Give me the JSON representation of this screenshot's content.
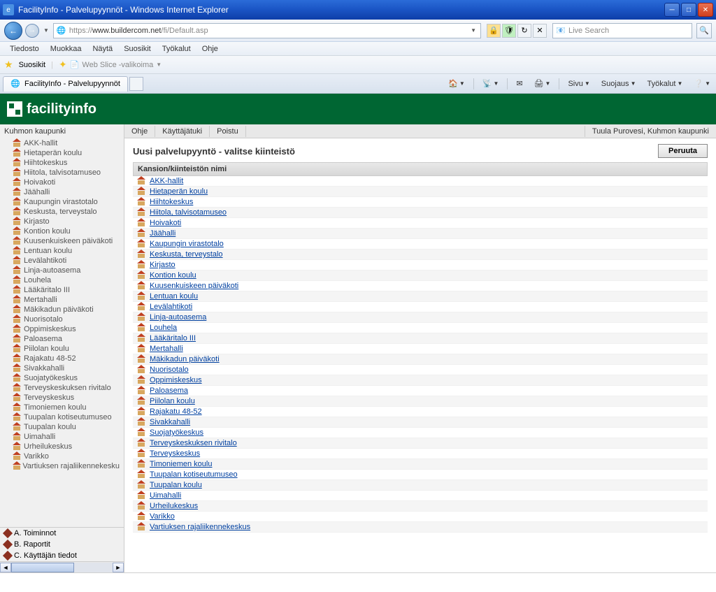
{
  "window": {
    "title": "FacilityInfo - Palvelupyynnöt - Windows Internet Explorer"
  },
  "address": {
    "protocol": "https://",
    "domain": "www.buildercom.net",
    "path": "/fi/Default.asp"
  },
  "search": {
    "placeholder": "Live Search"
  },
  "menus": {
    "tiedosto": "Tiedosto",
    "muokkaa": "Muokkaa",
    "nayta": "Näytä",
    "suosikit": "Suosikit",
    "tyokalut": "Työkalut",
    "ohje": "Ohje"
  },
  "favorites": {
    "label": "Suosikit",
    "webslice": "Web Slice -valikoima"
  },
  "tab": {
    "title": "FacilityInfo - Palvelupyynnöt"
  },
  "ie_toolbar": {
    "sivu": "Sivu",
    "suojaus": "Suojaus",
    "tyokalut": "Työkalut"
  },
  "app": {
    "logo": "facilityinfo"
  },
  "app_nav": {
    "ohje": "Ohje",
    "kayttajatuki": "Käyttäjätuki",
    "poistu": "Poistu",
    "user": "Tuula Purovesi, Kuhmon kaupunki"
  },
  "sidebar": {
    "root": "Kuhmon kaupunki",
    "items": [
      "AKK-hallit",
      "Hietaperän koulu",
      "Hiihtokeskus",
      "Hiitola, talvisotamuseo",
      "Hoivakoti",
      "Jäähalli",
      "Kaupungin virastotalo",
      "Keskusta, terveystalo",
      "Kirjasto",
      "Kontion koulu",
      "Kuusenkuiskeen päiväkoti",
      "Lentuan koulu",
      "Levälahtikoti",
      "Linja-autoasema",
      "Louhela",
      "Lääkäritalo III",
      "Mertahalli",
      "Mäkikadun päiväkoti",
      "Nuorisotalo",
      "Oppimiskeskus",
      "Paloasema",
      "Piilolan koulu",
      "Rajakatu 48-52",
      "Sivakkahalli",
      "Suojatyökeskus",
      "Terveyskeskuksen rivitalo",
      "Terveyskeskus",
      "Timoniemen koulu",
      "Tuupalan kotiseutumuseo",
      "Tuupalan koulu",
      "Uimahalli",
      "Urheilukeskus",
      "Varikko",
      "Vartiuksen rajaliikennekesku"
    ],
    "footer": {
      "a": "A. Toiminnot",
      "b": "B. Raportit",
      "c": "C. Käyttäjän tiedot"
    }
  },
  "content": {
    "title": "Uusi palvelupyyntö - valitse kiinteistö",
    "cancel": "Peruuta",
    "col_header": "Kansion/kiinteistön nimi",
    "rows": [
      "AKK-hallit",
      "Hietaperän koulu",
      "Hiihtokeskus",
      "Hiitola, talvisotamuseo",
      "Hoivakoti",
      "Jäähalli",
      "Kaupungin virastotalo",
      "Keskusta, terveystalo",
      "Kirjasto",
      "Kontion koulu",
      "Kuusenkuiskeen päiväkoti",
      "Lentuan koulu",
      "Levälahtikoti",
      "Linja-autoasema",
      "Louhela",
      "Lääkäritalo III",
      "Mertahalli",
      "Mäkikadun päiväkoti",
      "Nuorisotalo",
      "Oppimiskeskus",
      "Paloasema",
      "Piilolan koulu",
      "Rajakatu 48-52",
      "Sivakkahalli",
      "Suojatyökeskus",
      "Terveyskeskuksen rivitalo",
      "Terveyskeskus",
      "Timoniemen koulu",
      "Tuupalan kotiseutumuseo",
      "Tuupalan koulu",
      "Uimahalli",
      "Urheilukeskus",
      "Varikko",
      "Vartiuksen rajaliikennekeskus"
    ]
  }
}
